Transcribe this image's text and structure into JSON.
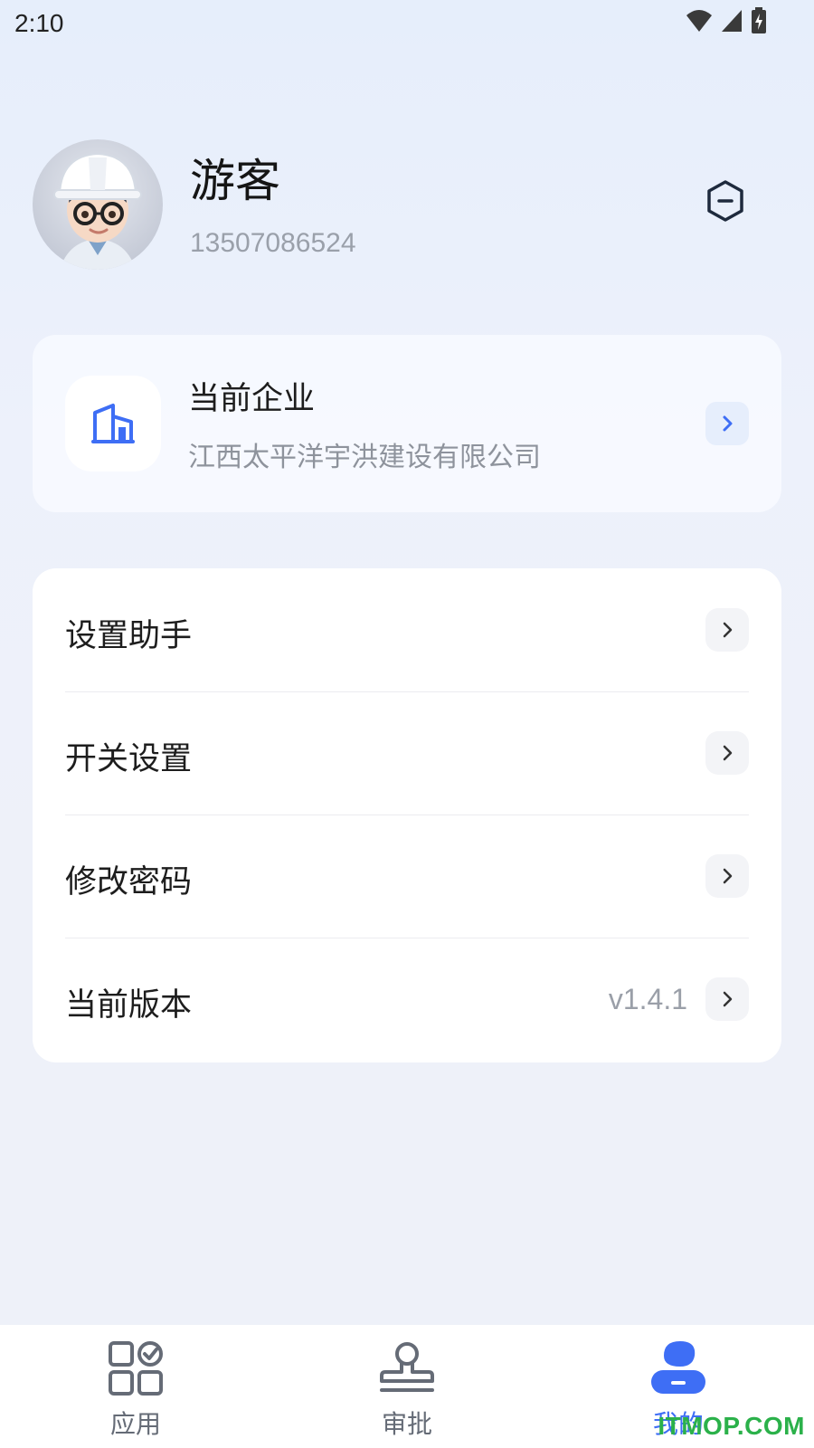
{
  "status_bar": {
    "time": "2:10"
  },
  "profile": {
    "name": "游客",
    "phone": "13507086524"
  },
  "enterprise": {
    "title": "当前企业",
    "name": "江西太平洋宇洪建设有限公司"
  },
  "menu": {
    "items": [
      {
        "label": "设置助手",
        "value": ""
      },
      {
        "label": "开关设置",
        "value": ""
      },
      {
        "label": "修改密码",
        "value": ""
      },
      {
        "label": "当前版本",
        "value": "v1.4.1"
      }
    ]
  },
  "tabbar": {
    "tabs": [
      {
        "label": "应用",
        "icon": "apps-icon",
        "active": false
      },
      {
        "label": "审批",
        "icon": "stamp-icon",
        "active": false
      },
      {
        "label": "我的",
        "icon": "profile-icon",
        "active": true
      }
    ]
  },
  "colors": {
    "accent": "#3e6ef5",
    "background": "#eef1f9",
    "card": "#ffffff"
  },
  "watermark": "ITMOP.COM"
}
